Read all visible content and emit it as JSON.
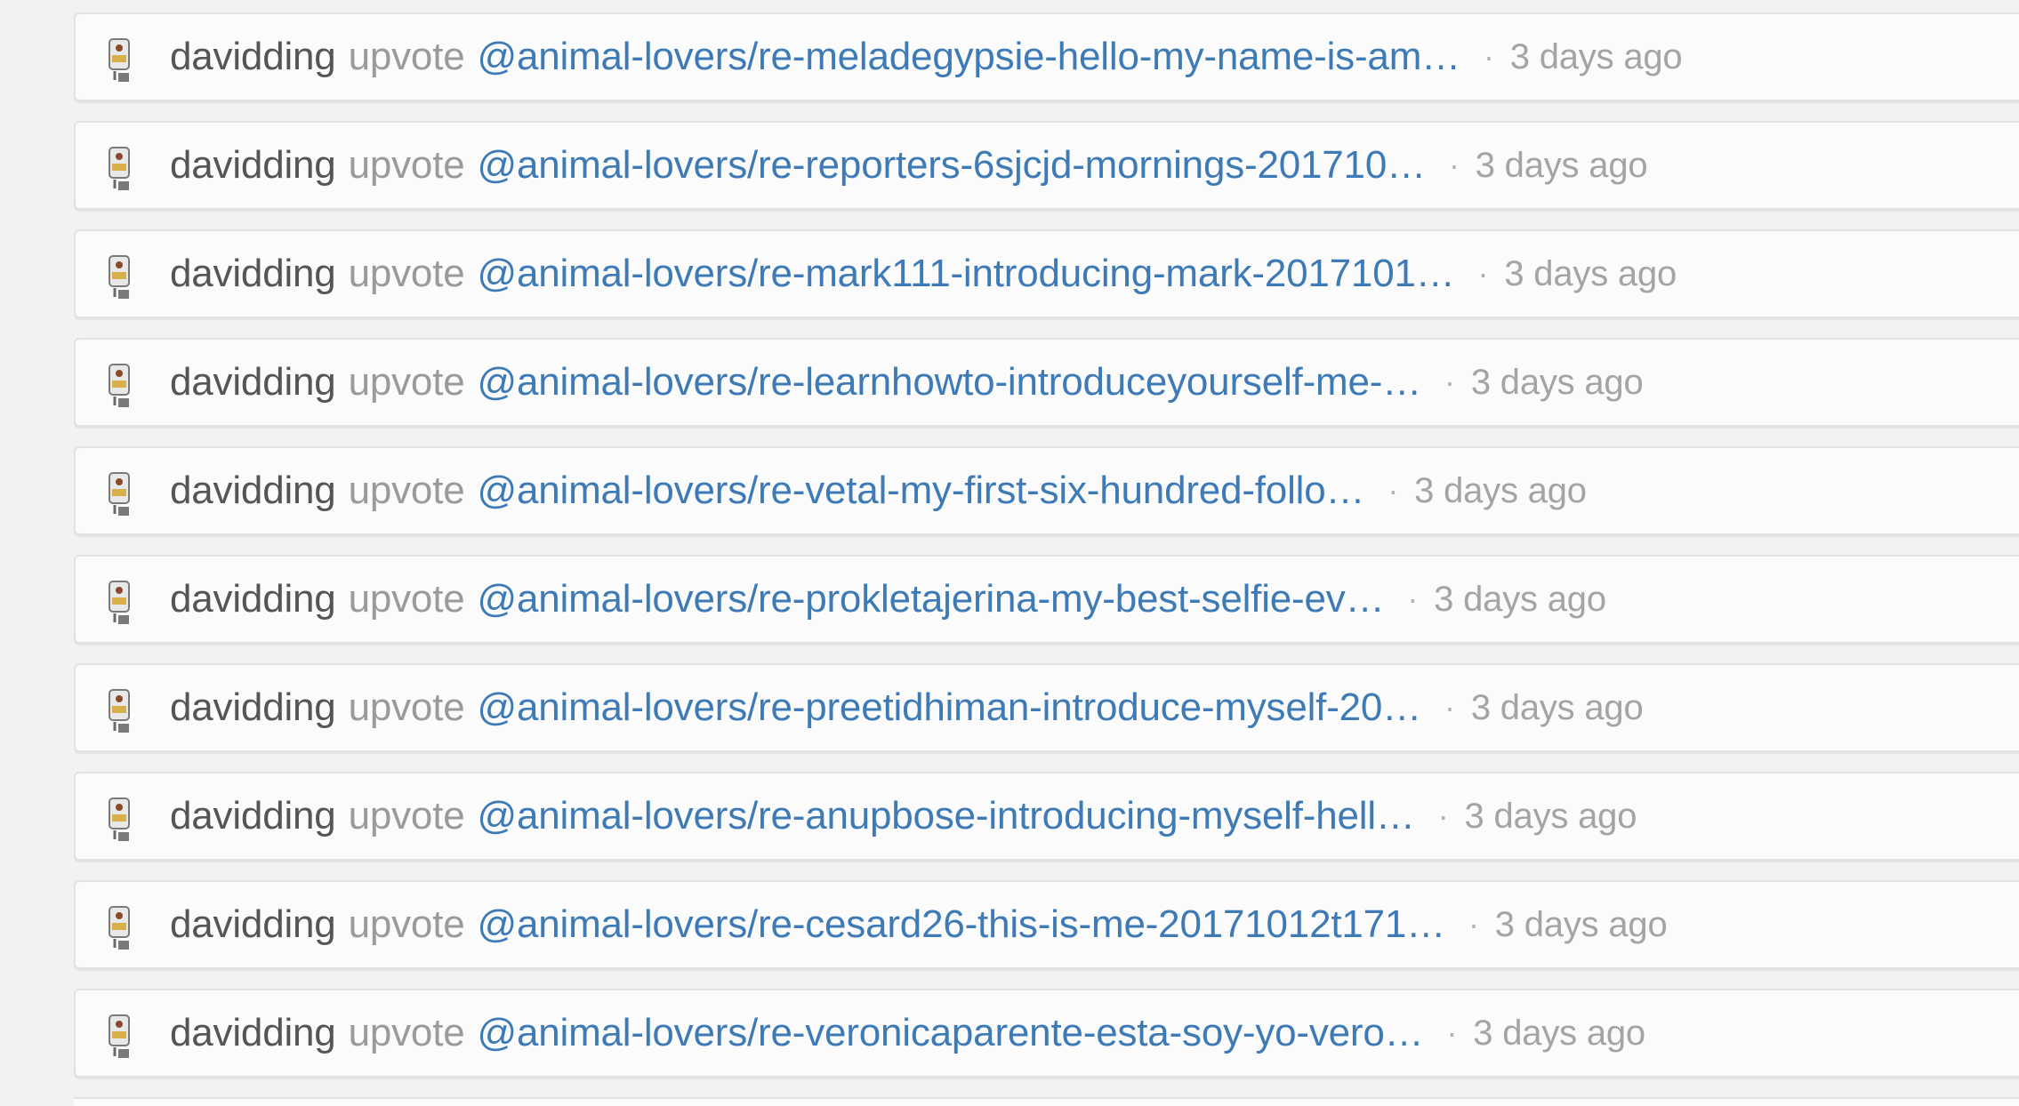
{
  "feed": {
    "items": [
      {
        "author": "davidding",
        "action": "upvote",
        "link": "@animal-lovers/re-meladegypsie-hello-my-name-is-am…",
        "separator": "·",
        "time": "3 days ago"
      },
      {
        "author": "davidding",
        "action": "upvote",
        "link": "@animal-lovers/re-reporters-6sjcjd-mornings-201710…",
        "separator": "·",
        "time": "3 days ago"
      },
      {
        "author": "davidding",
        "action": "upvote",
        "link": "@animal-lovers/re-mark111-introducing-mark-2017101…",
        "separator": "·",
        "time": "3 days ago"
      },
      {
        "author": "davidding",
        "action": "upvote",
        "link": "@animal-lovers/re-learnhowto-introduceyourself-me-…",
        "separator": "·",
        "time": "3 days ago"
      },
      {
        "author": "davidding",
        "action": "upvote",
        "link": "@animal-lovers/re-vetal-my-first-six-hundred-follo…",
        "separator": "·",
        "time": "3 days ago"
      },
      {
        "author": "davidding",
        "action": "upvote",
        "link": "@animal-lovers/re-prokletajerina-my-best-selfie-ev…",
        "separator": "·",
        "time": "3 days ago"
      },
      {
        "author": "davidding",
        "action": "upvote",
        "link": "@animal-lovers/re-preetidhiman-introduce-myself-20…",
        "separator": "·",
        "time": "3 days ago"
      },
      {
        "author": "davidding",
        "action": "upvote",
        "link": "@animal-lovers/re-anupbose-introducing-myself-hell…",
        "separator": "·",
        "time": "3 days ago"
      },
      {
        "author": "davidding",
        "action": "upvote",
        "link": "@animal-lovers/re-cesard26-this-is-me-20171012t171…",
        "separator": "·",
        "time": "3 days ago"
      },
      {
        "author": "davidding",
        "action": "upvote",
        "link": "@animal-lovers/re-veronicaparente-esta-soy-yo-vero…",
        "separator": "·",
        "time": "3 days ago"
      }
    ]
  },
  "colors": {
    "link": "#3e7bb6",
    "author": "#555555",
    "muted": "#9a9a9a",
    "background": "#f2f2f2"
  },
  "icons": {
    "avatar": "user-avatar-icon"
  }
}
